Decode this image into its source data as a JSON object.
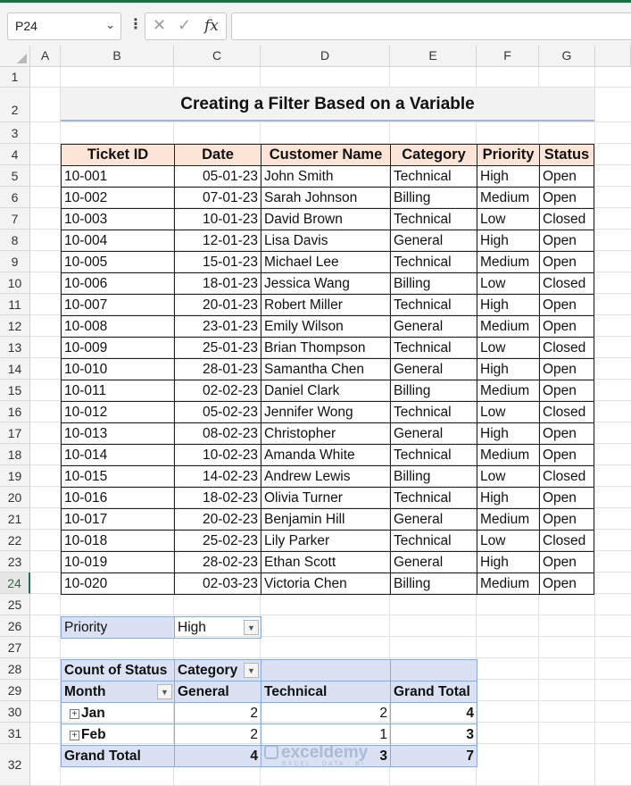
{
  "formula_bar": {
    "name_box": "P24",
    "cancel_icon": "✕",
    "enter_icon": "✓",
    "fx_label": "fx",
    "formula": ""
  },
  "columns": [
    "A",
    "B",
    "C",
    "D",
    "E",
    "F",
    "G"
  ],
  "rows": [
    "1",
    "2",
    "3",
    "4",
    "5",
    "6",
    "7",
    "8",
    "9",
    "10",
    "11",
    "12",
    "13",
    "14",
    "15",
    "16",
    "17",
    "18",
    "19",
    "20",
    "21",
    "22",
    "23",
    "24",
    "25",
    "26",
    "27",
    "28",
    "29",
    "30",
    "31",
    "32"
  ],
  "selected_row": "24",
  "title": "Creating a Filter Based on a Variable",
  "table": {
    "headers": [
      "Ticket ID",
      "Date",
      "Customer Name",
      "Category",
      "Priority",
      "Status"
    ],
    "rows": [
      [
        "10-001",
        "05-01-23",
        "John Smith",
        "Technical",
        "High",
        "Open"
      ],
      [
        "10-002",
        "07-01-23",
        "Sarah Johnson",
        "Billing",
        "Medium",
        "Open"
      ],
      [
        "10-003",
        "10-01-23",
        "David Brown",
        "Technical",
        "Low",
        "Closed"
      ],
      [
        "10-004",
        "12-01-23",
        "Lisa Davis",
        "General",
        "High",
        "Open"
      ],
      [
        "10-005",
        "15-01-23",
        "Michael Lee",
        "Technical",
        "Medium",
        "Open"
      ],
      [
        "10-006",
        "18-01-23",
        "Jessica Wang",
        "Billing",
        "Low",
        "Closed"
      ],
      [
        "10-007",
        "20-01-23",
        "Robert Miller",
        "Technical",
        "High",
        "Open"
      ],
      [
        "10-008",
        "23-01-23",
        "Emily Wilson",
        "General",
        "Medium",
        "Open"
      ],
      [
        "10-009",
        "25-01-23",
        "Brian Thompson",
        "Technical",
        "Low",
        "Closed"
      ],
      [
        "10-010",
        "28-01-23",
        "Samantha Chen",
        "General",
        "High",
        "Open"
      ],
      [
        "10-011",
        "02-02-23",
        "Daniel Clark",
        "Billing",
        "Medium",
        "Open"
      ],
      [
        "10-012",
        "05-02-23",
        "Jennifer Wong",
        "Technical",
        "Low",
        "Closed"
      ],
      [
        "10-013",
        "08-02-23",
        "Christopher",
        "General",
        "High",
        "Open"
      ],
      [
        "10-014",
        "10-02-23",
        "Amanda White",
        "Technical",
        "Medium",
        "Open"
      ],
      [
        "10-015",
        "14-02-23",
        "Andrew Lewis",
        "Billing",
        "Low",
        "Closed"
      ],
      [
        "10-016",
        "18-02-23",
        "Olivia Turner",
        "Technical",
        "High",
        "Open"
      ],
      [
        "10-017",
        "20-02-23",
        "Benjamin Hill",
        "General",
        "Medium",
        "Open"
      ],
      [
        "10-018",
        "25-02-23",
        "Lily Parker",
        "Technical",
        "Low",
        "Closed"
      ],
      [
        "10-019",
        "28-02-23",
        "Ethan Scott",
        "General",
        "High",
        "Open"
      ],
      [
        "10-020",
        "02-03-23",
        "Victoria Chen",
        "Billing",
        "Medium",
        "Open"
      ]
    ]
  },
  "pivot": {
    "filter_label": "Priority",
    "filter_value": "High",
    "values_label": "Count of Status",
    "column_field": "Category",
    "row_field": "Month",
    "column_headers": [
      "General",
      "Technical",
      "Grand Total"
    ],
    "rows": [
      {
        "label": "Jan",
        "values": [
          "2",
          "2",
          "4"
        ]
      },
      {
        "label": "Feb",
        "values": [
          "2",
          "1",
          "3"
        ]
      }
    ],
    "grand_total": {
      "label": "Grand Total",
      "values": [
        "4",
        "3",
        "7"
      ]
    }
  },
  "watermark": {
    "brand": "exceldemy",
    "tagline": "EXCEL · DATA · BI"
  },
  "colors": {
    "accent": "#1e7145",
    "header_fill": "#fce4d6",
    "pivot_fill": "#d9e1f2",
    "pivot_border": "#8ea9db"
  }
}
